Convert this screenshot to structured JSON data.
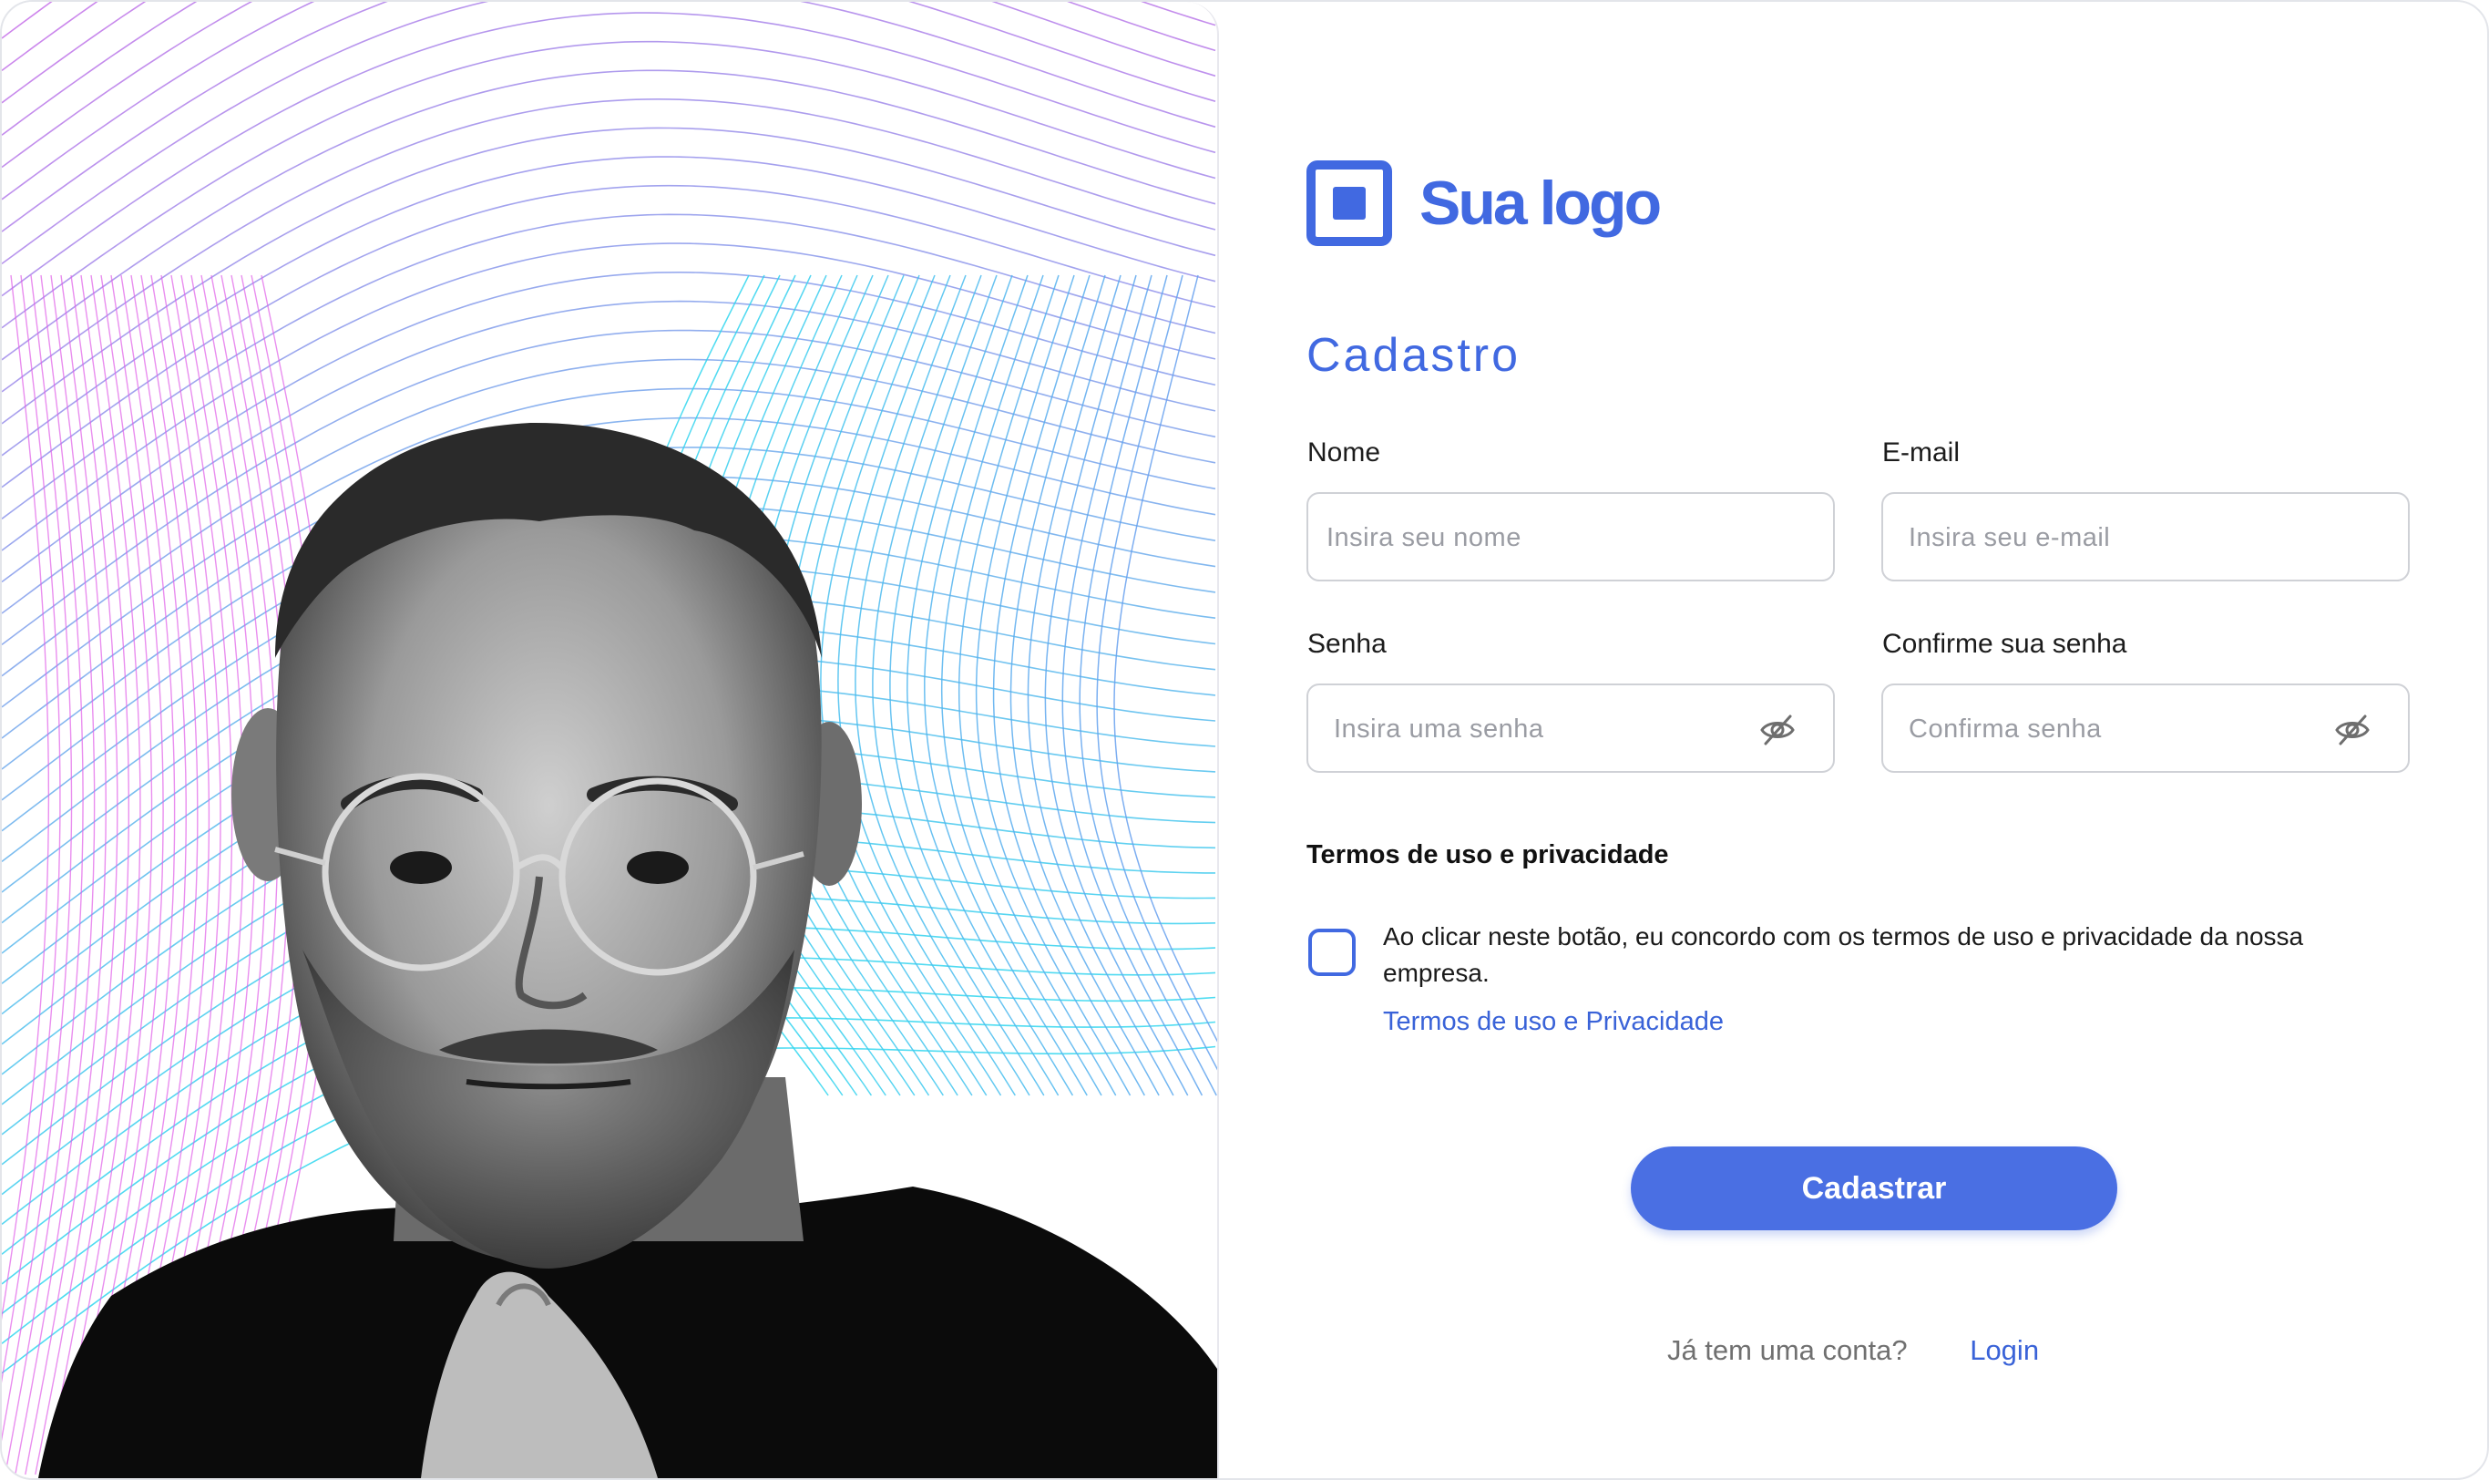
{
  "logo": {
    "text": "Sua logo"
  },
  "form": {
    "title": "Cadastro",
    "name": {
      "label": "Nome",
      "placeholder": "Insira seu nome",
      "value": ""
    },
    "email": {
      "label": "E-mail",
      "placeholder": "Insira seu e-mail",
      "value": ""
    },
    "password": {
      "label": "Senha",
      "placeholder": "Insira uma senha",
      "value": "",
      "toggle_icon": "eye-off-icon"
    },
    "confirm": {
      "label": "Confirme sua senha",
      "placeholder": "Confirma senha",
      "value": "",
      "toggle_icon": "eye-off-icon"
    }
  },
  "terms": {
    "title": "Termos de uso e privacidade",
    "checked": false,
    "consent_text": "Ao clicar neste botão, eu concordo com os  termos de uso e privacidade da nossa empresa.",
    "link_terms": "Termos de uso",
    "connector": "e",
    "link_privacy": "Privacidade"
  },
  "submit": {
    "label": "Cadastrar"
  },
  "footer": {
    "question": "Já tem uma conta?",
    "login_link": "Login"
  },
  "colors": {
    "accent": "#4169e1",
    "wave_pink": "#e05ee8",
    "wave_cyan": "#2fd6ee"
  }
}
